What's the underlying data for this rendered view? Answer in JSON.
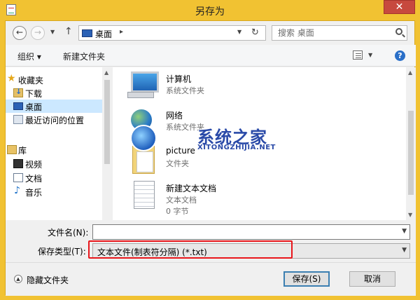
{
  "window": {
    "title": "另存为",
    "close_label": "✕"
  },
  "nav": {
    "address_path": "桌面",
    "search_placeholder": "搜索 桌面"
  },
  "toolbar": {
    "organize_label": "组织 ▾",
    "new_folder_label": "新建文件夹",
    "help_label": "?"
  },
  "sidebar": {
    "favorites_label": "收藏夹",
    "items": [
      {
        "label": "下载"
      },
      {
        "label": "桌面"
      },
      {
        "label": "最近访问的位置"
      }
    ],
    "libraries_label": "库",
    "library_items": [
      {
        "label": "视频"
      },
      {
        "label": "文档"
      },
      {
        "label": "音乐"
      }
    ]
  },
  "files": [
    {
      "name": "计算机",
      "type": "系统文件夹"
    },
    {
      "name": "网络",
      "type": "系统文件夹"
    },
    {
      "name": "picture",
      "type": "文件夹"
    },
    {
      "name": "新建文本文档",
      "type": "文本文档",
      "size": "0 字节"
    }
  ],
  "watermark": {
    "title": "系统之家",
    "subtitle": "XITONGZHIJIA.NET"
  },
  "form": {
    "filename_label": "文件名(N):",
    "filename_value": "",
    "filetype_label": "保存类型(T):",
    "filetype_value": "文本文件(制表符分隔) (*.txt)"
  },
  "footer": {
    "hide_folders_label": "隐藏文件夹",
    "save_label": "保存(S)",
    "cancel_label": "取消"
  }
}
